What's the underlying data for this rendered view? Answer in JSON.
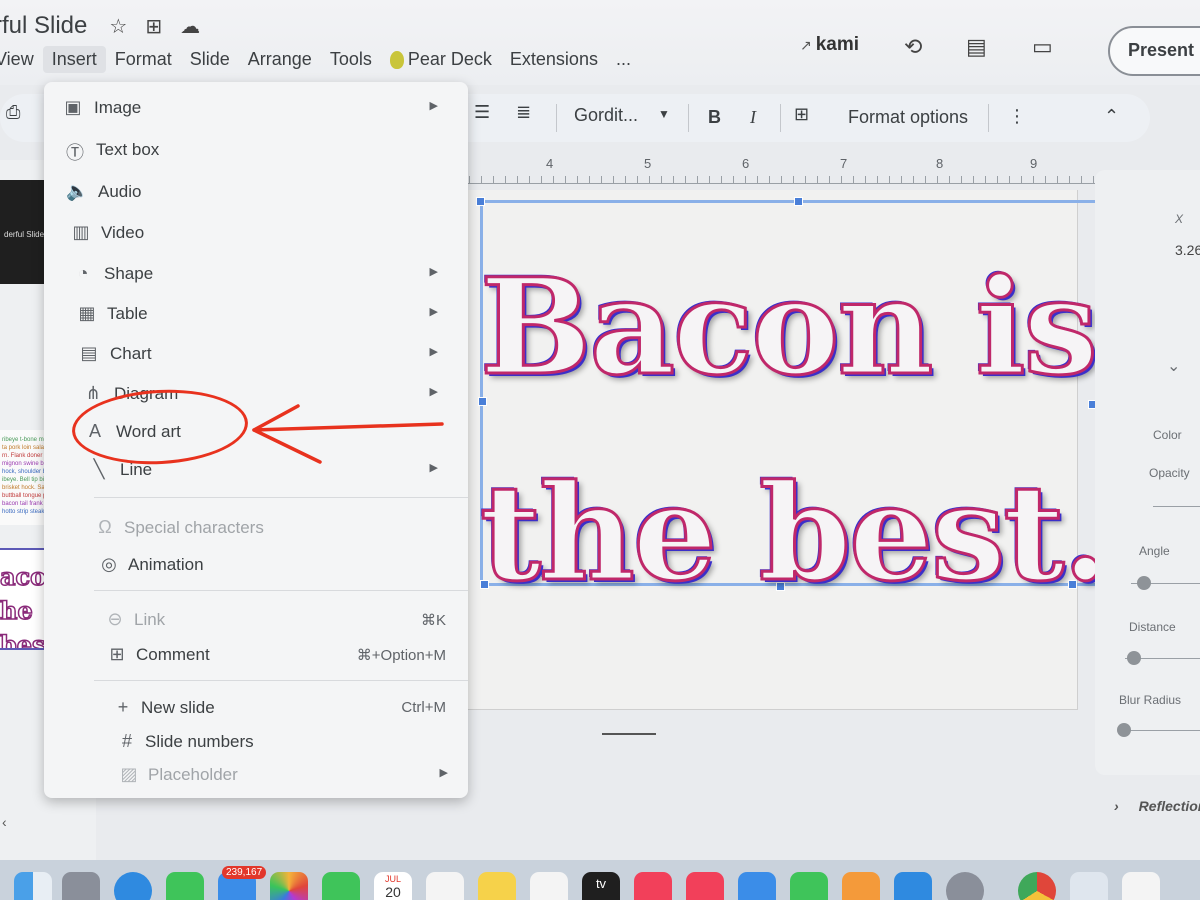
{
  "app": {
    "doc_title": "rful Slide",
    "menubar": [
      "View",
      "Insert",
      "Format",
      "Slide",
      "Arrange",
      "Tools",
      "Pear Deck",
      "Extensions",
      "..."
    ],
    "kami_label": "kami",
    "present_label": "Present"
  },
  "toolbar": {
    "font_name": "Gordit...",
    "bold_label": "B",
    "italic_label": "I",
    "format_options_label": "Format options"
  },
  "ruler": {
    "numbers": [
      "4",
      "5",
      "6",
      "7",
      "8",
      "9"
    ]
  },
  "filmstrip": {
    "thumb1_title": "derful Slide",
    "thumb2_lines": [
      "ribeye t-bone meatb",
      "ta pork loin salami fil",
      "rn. Flank doner ham",
      "mignon swine beef ri",
      "hock, shoulder beef",
      "ibeye. Bell tip biltong",
      "brisket hock. Sausage",
      "buttball tongue pig bacon",
      "bacon tail frank sausage",
      "hotto strip steak."
    ],
    "thumb3_line1": "acon i",
    "thumb3_line2": "he best"
  },
  "slide": {
    "wordart_line1": "Bacon is",
    "wordart_line2": "the best."
  },
  "insert_menu": {
    "items": [
      {
        "icon": "image-icon",
        "label": "Image",
        "submenu": true
      },
      {
        "icon": "text-box-icon",
        "label": "Text box"
      },
      {
        "icon": "audio-icon",
        "label": "Audio"
      },
      {
        "icon": "video-icon",
        "label": "Video"
      },
      {
        "icon": "shape-icon",
        "label": "Shape",
        "submenu": true
      },
      {
        "icon": "table-icon",
        "label": "Table",
        "submenu": true
      },
      {
        "icon": "chart-icon",
        "label": "Chart",
        "submenu": true
      },
      {
        "icon": "diagram-icon",
        "label": "Diagram",
        "submenu": true
      },
      {
        "icon": "word-art-icon",
        "label": "Word art"
      },
      {
        "icon": "line-icon",
        "label": "Line",
        "submenu": true
      },
      {
        "icon": "omega-icon",
        "label": "Special characters",
        "disabled": true
      },
      {
        "icon": "animation-icon",
        "label": "Animation"
      },
      {
        "icon": "link-icon",
        "label": "Link",
        "shortcut": "⌘K",
        "disabled": true
      },
      {
        "icon": "comment-icon",
        "label": "Comment",
        "shortcut": "⌘+Option+M"
      },
      {
        "icon": "plus-icon",
        "label": "New slide",
        "shortcut": "Ctrl+M"
      },
      {
        "icon": "hash-icon",
        "label": "Slide numbers"
      },
      {
        "icon": "placeholder-icon",
        "label": "Placeholder",
        "submenu": true,
        "disabled": true
      }
    ]
  },
  "right_panel": {
    "x_label": "X",
    "x_value": "3.26",
    "color_label": "Color",
    "opacity_label": "Opacity",
    "angle_label": "Angle",
    "distance_label": "Distance",
    "blur_label": "Blur Radius",
    "reflection_label": "Reflection"
  },
  "dock": {
    "mail_badge": "239,167",
    "calendar_month": "JUL",
    "calendar_day": "20",
    "tv_label": "tv"
  },
  "colors": {
    "annotation_red": "#e8321e",
    "wordart_outline": "#c0286a",
    "wordart_shadow": "#3b2fc9",
    "selection_blue": "#4a7fd8"
  }
}
